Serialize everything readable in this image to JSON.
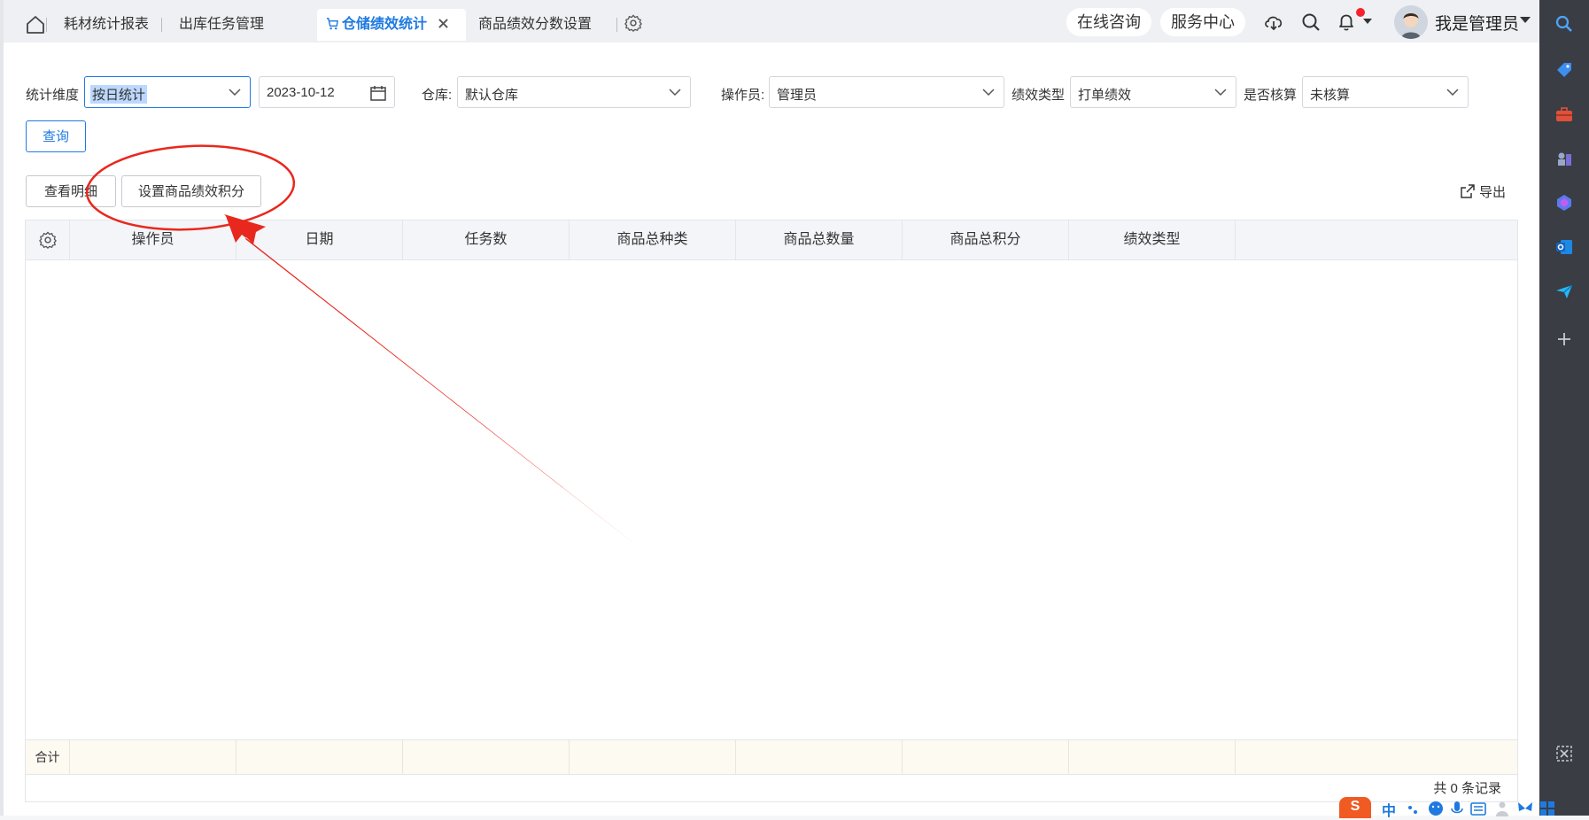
{
  "tabs": [
    {
      "label": "耗材统计报表"
    },
    {
      "label": "出库任务管理"
    },
    {
      "label": "仓储绩效统计",
      "active": true
    },
    {
      "label": "商品绩效分数设置"
    }
  ],
  "header": {
    "consult": "在线咨询",
    "service": "服务中心",
    "user": "我是管理员"
  },
  "filters": {
    "dimension_label": "统计维度",
    "dimension_value": "按日统计",
    "date_value": "2023-10-12",
    "warehouse_label": "仓库:",
    "warehouse_value": "默认仓库",
    "operator_label": "操作员:",
    "operator_value": "管理员",
    "perf_type_label": "绩效类型",
    "perf_type_value": "打单绩效",
    "audited_label": "是否核算",
    "audited_value": "未核算",
    "query_button": "查询"
  },
  "toolbar": {
    "detail_button": "查看明细",
    "set_score_button": "设置商品绩效积分",
    "export_label": "导出"
  },
  "table": {
    "columns": [
      "操作员",
      "日期",
      "任务数",
      "商品总种类",
      "商品总数量",
      "商品总积分",
      "绩效类型"
    ],
    "footer_label": "合计",
    "total_records": "共 0 条记录"
  },
  "ime": {
    "logo": "S",
    "mode": "中"
  },
  "colors": {
    "accent": "#1f7ae0",
    "annotation": "#e8281e",
    "notification_dot": "#f5222d"
  }
}
